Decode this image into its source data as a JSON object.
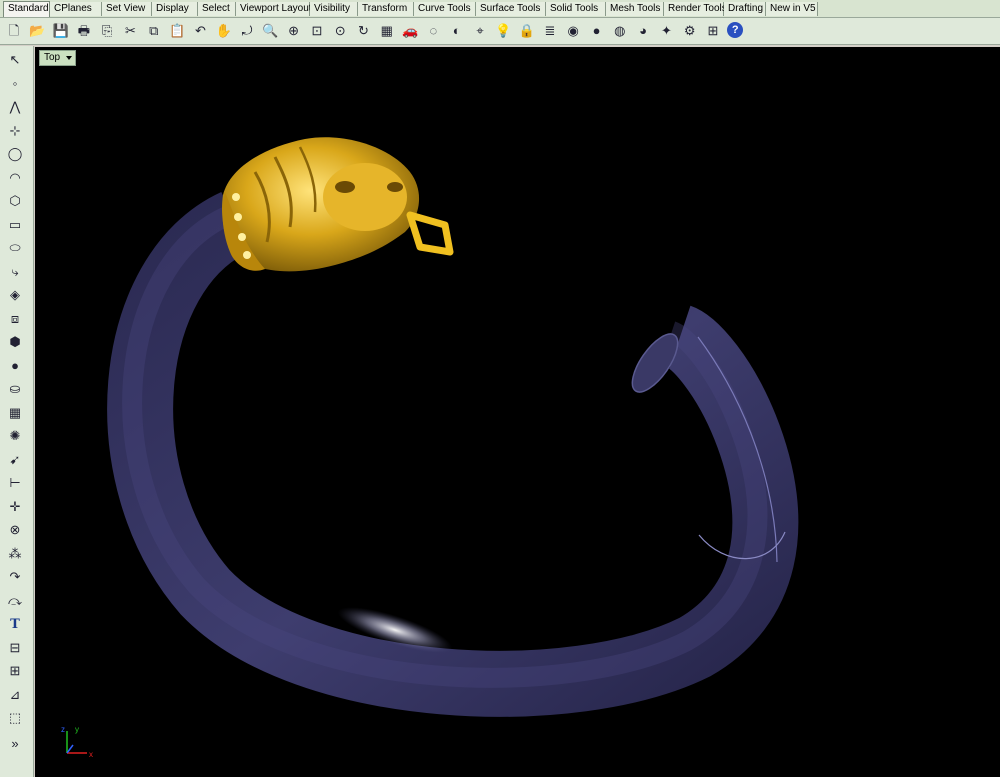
{
  "tabs": [
    "Standard",
    "CPlanes",
    "Set View",
    "Display",
    "Select",
    "Viewport Layout",
    "Visibility",
    "Transform",
    "Curve Tools",
    "Surface Tools",
    "Solid Tools",
    "Mesh Tools",
    "Render Tools",
    "Drafting",
    "New in V5"
  ],
  "active_tab": "Standard",
  "viewport": {
    "label": "Top"
  },
  "sidebar": {
    "more_label": "»"
  },
  "axes": {
    "x_label": "x",
    "y_label": "y",
    "z_label": "z"
  },
  "colors": {
    "tube": "#3d3c6a",
    "gold": "#d4a416",
    "background": "#000000",
    "ui": "#dfe9da"
  },
  "toolbar_icons": [
    "new-file-icon",
    "open-folder-icon",
    "save-icon",
    "print-icon",
    "import-icon",
    "cut-icon",
    "copy-icon",
    "paste-icon",
    "undo-icon",
    "pan-hand-icon",
    "rotate-view-icon",
    "zoom-icon",
    "zoom-window-icon",
    "zoom-extents-icon",
    "zoom-selected-icon",
    "rotate-icon",
    "viewport-layout-icon",
    "car-icon",
    "hide-icon",
    "show-icon",
    "snap-icon",
    "light-icon",
    "lock-icon",
    "layer-icon",
    "color-wheel-icon",
    "material-sphere-icon",
    "render-sphere-icon",
    "shaded-sphere-icon",
    "options-icon",
    "gear-icon",
    "grid-snap-icon",
    "help-icon"
  ],
  "sidebar_icons": [
    "select-arrow-icon",
    "point-icon",
    "polyline-icon",
    "curve-point-icon",
    "circle-icon",
    "arc-icon",
    "polygon-icon",
    "rectangle-icon",
    "ellipse-icon",
    "curve-fillet-icon",
    "surface-edit-icon",
    "extrude-icon",
    "box-solid-icon",
    "sphere-solid-icon",
    "cylinder-solid-icon",
    "mesh-icon",
    "gear-tools-icon",
    "transform-icon",
    "dimension-icon",
    "move-icon",
    "boolean-icon",
    "cluster-icon",
    "rotate-curve-icon",
    "bend-icon",
    "text-icon",
    "group-icon",
    "block-icon",
    "edit-icon",
    "cube-icon"
  ]
}
